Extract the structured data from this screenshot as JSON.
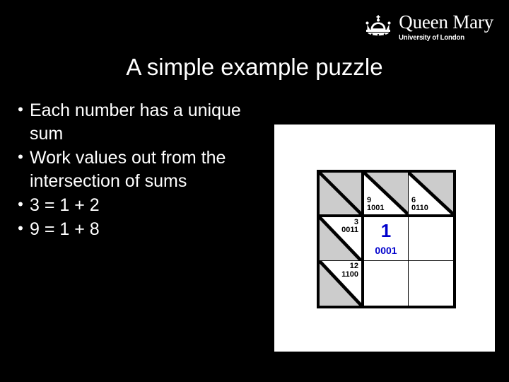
{
  "slide": {
    "background_color": "#000000",
    "text_color": "#ffffff",
    "title": "A simple example puzzle"
  },
  "logo": {
    "icon": "crown-icon",
    "name": "Queen Mary",
    "subtitle": "University of London"
  },
  "bullets": [
    {
      "marker": "•",
      "text": "Each number has a unique sum"
    },
    {
      "marker": "•",
      "text": "Work values out from the intersection of sums"
    },
    {
      "marker": "•",
      "text": "3 = 1 + 2"
    },
    {
      "marker": "•",
      "text": "9 = 1 + 8"
    }
  ],
  "puzzle": {
    "panel_background": "#ffffff",
    "shade_color": "#cccccc",
    "answer_color": "#0000cc",
    "rows": 3,
    "cols": 3,
    "cells": [
      {
        "id": "c00",
        "kind": "corner",
        "shade": "full",
        "diagonal": true,
        "decimal": "",
        "binary": ""
      },
      {
        "id": "c01",
        "kind": "col-clue",
        "shade": "upper-right",
        "diagonal": true,
        "decimal": "9",
        "binary": "1001"
      },
      {
        "id": "c02",
        "kind": "col-clue",
        "shade": "upper-right",
        "diagonal": true,
        "decimal": "6",
        "binary": "0110"
      },
      {
        "id": "c10",
        "kind": "row-clue",
        "shade": "lower-left",
        "diagonal": true,
        "decimal": "3",
        "binary": "0011"
      },
      {
        "id": "c11",
        "kind": "answer",
        "shade": "none",
        "diagonal": false,
        "decimal": "1",
        "binary": "0001"
      },
      {
        "id": "c12",
        "kind": "empty",
        "shade": "none",
        "diagonal": false,
        "decimal": "",
        "binary": ""
      },
      {
        "id": "c20",
        "kind": "row-clue",
        "shade": "lower-left",
        "diagonal": true,
        "decimal": "12",
        "binary": "1100"
      },
      {
        "id": "c21",
        "kind": "empty",
        "shade": "none",
        "diagonal": false,
        "decimal": "",
        "binary": ""
      },
      {
        "id": "c22",
        "kind": "empty",
        "shade": "none",
        "diagonal": false,
        "decimal": "",
        "binary": ""
      }
    ]
  }
}
